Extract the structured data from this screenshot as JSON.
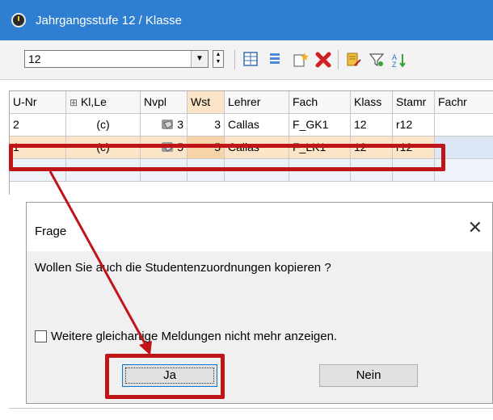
{
  "window": {
    "title": "Jahrgangsstufe 12 / Klasse"
  },
  "toolbar": {
    "combo_value": "12",
    "icons": [
      "grid-icon",
      "list-icon",
      "new-icon",
      "delete-icon",
      "report-icon",
      "filter-icon",
      "sort-icon"
    ]
  },
  "grid": {
    "headers": [
      "U-Nr",
      "Kl,Le",
      "Nvpl",
      "Wst",
      "Lehrer",
      "Fach",
      "Klass",
      "Stamr",
      "Fachr"
    ],
    "header_expand": "⊞",
    "rows": [
      {
        "unr": "2",
        "klle": "(c)",
        "nvpl": "3",
        "wst": "3",
        "lehrer": "Callas",
        "fach": "F_GK1",
        "klass": "12",
        "stamm": "r12"
      },
      {
        "unr": "1",
        "klle": "(c)",
        "nvpl": "5",
        "wst": "5",
        "lehrer": "Callas",
        "fach": "F_LK1",
        "klass": "12",
        "stamm": "r12"
      }
    ]
  },
  "dialog": {
    "title": "Frage",
    "close": "✕",
    "message": "Wollen Sie auch die Studentenzuordnungen kopieren ?",
    "checkbox_label": "Weitere gleichartige Meldungen nicht mehr anzeigen.",
    "yes_label": "Ja",
    "no_label": "Nein"
  },
  "colors": {
    "titlebar": "#2e7fd1",
    "highlight": "#c01518",
    "selected_row": "#fbe4c8"
  }
}
